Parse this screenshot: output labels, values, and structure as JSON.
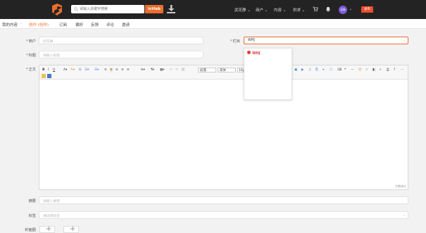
{
  "header": {
    "search_placeholder": "请输入关键字搜索",
    "search_button": "ictfab",
    "nav": [
      "武花静",
      "商户",
      "内容",
      "供求"
    ],
    "avatar_text": "花静",
    "post_button": "发布"
  },
  "subnav": {
    "breadcrumb": "我的内容",
    "items": [
      "创作 (创作)",
      "订阅",
      "偏好",
      "反馈",
      "评论",
      "邀请"
    ]
  },
  "form": {
    "merchant_label": "商户",
    "merchant_placeholder": "武花静",
    "column_label": "栏目",
    "column_value": "WHJ",
    "column_option": "WHJ",
    "title_label": "标题",
    "title_placeholder": "请输入标题",
    "body_label": "正文",
    "summary_label": "摘要",
    "summary_placeholder": "请输入摘要",
    "tags_label": "标签",
    "tags_placeholder": "请选择标签",
    "cover_label": "封面图",
    "editor_footer": "字数统计"
  },
  "toolbar": {
    "format": "段落",
    "font": "宋体",
    "size": "16px"
  },
  "colors": {
    "topbar": "#232323",
    "accent": "#e96e2f",
    "danger": "#e4393c"
  }
}
